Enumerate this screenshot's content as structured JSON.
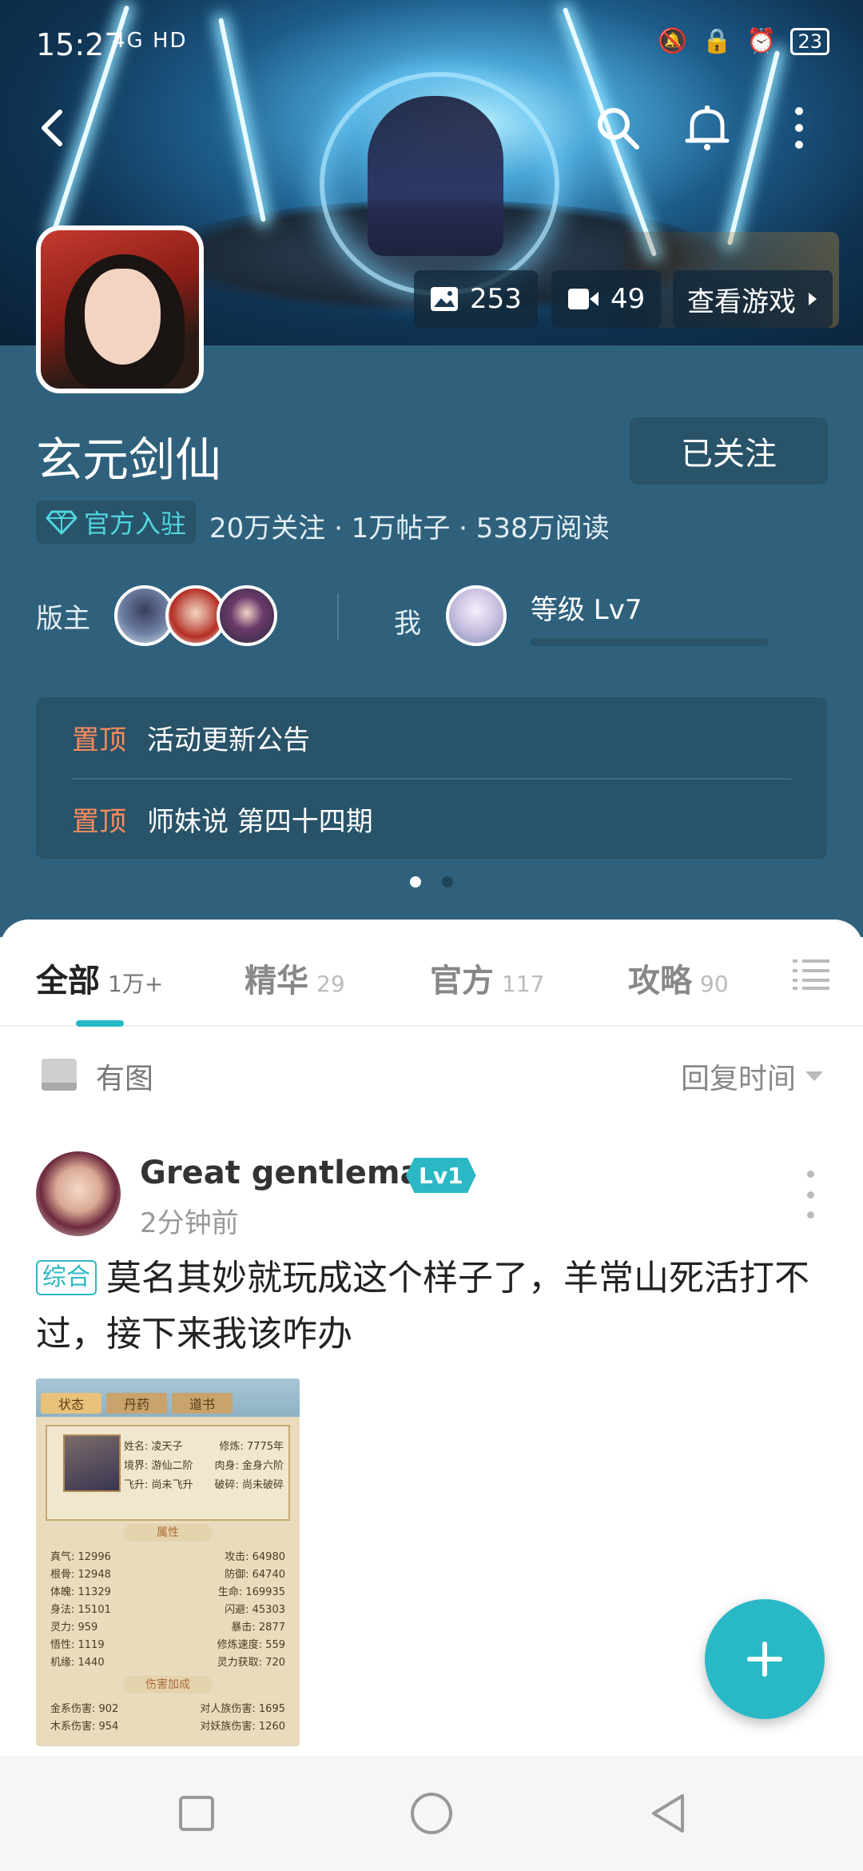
{
  "status_bar": {
    "time": "15:27",
    "signal_text": "4G HD",
    "battery": "23"
  },
  "top_nav": {
    "back_icon": "chevron-left-icon",
    "search_icon": "search-icon",
    "bell_icon": "bell-icon",
    "more_icon": "more-vertical-icon"
  },
  "media": {
    "images_count": "253",
    "videos_count": "49",
    "view_game_label": "查看游戏"
  },
  "forum": {
    "title": "玄元剑仙",
    "follow_label": "已关注",
    "official_label": "官方入驻",
    "stats": "20万关注 · 1万帖子 · 538万阅读",
    "moderator_label": "版主",
    "me_label": "我",
    "level_text": "等级 Lv7",
    "level_progress": 0
  },
  "pinned": [
    {
      "tag": "置顶",
      "text": "活动更新公告"
    },
    {
      "tag": "置顶",
      "text": "师妹说 第四十四期"
    }
  ],
  "pager": {
    "pages": 2,
    "active": 0
  },
  "tabs": [
    {
      "name": "全部",
      "count": "1万+"
    },
    {
      "name": "精华",
      "count": "29"
    },
    {
      "name": "官方",
      "count": "117"
    },
    {
      "name": "攻略",
      "count": "90"
    }
  ],
  "filter": {
    "has_image_label": "有图",
    "sort_label": "回复时间"
  },
  "post": {
    "username": "Great gentleman",
    "level_badge": "Lv1",
    "time": "2分钟前",
    "category": "综合",
    "text": "莫名其妙就玩成这个样子了，羊常山死活打不过，接下来我该咋办",
    "screenshot": {
      "tabs": [
        "状态",
        "丹药",
        "道书"
      ],
      "profile": [
        [
          "姓名: 凌天子",
          "修炼: 7775年"
        ],
        [
          "境界: 游仙二阶",
          "肉身: 金身六阶"
        ],
        [
          "飞升: 尚未飞升",
          "破碎: 尚未破碎"
        ]
      ],
      "attr_header": "属性",
      "attrs": [
        [
          "真气: 12996",
          "攻击: 64980"
        ],
        [
          "根骨: 12948",
          "防御: 64740"
        ],
        [
          "体魄: 11329",
          "生命: 169935"
        ],
        [
          "身法: 15101",
          "闪避: 45303"
        ],
        [
          "灵力: 959",
          "暴击: 2877"
        ],
        [
          "悟性: 1119",
          "修炼速度: 559"
        ],
        [
          "机缘: 1440",
          "灵力获取: 720"
        ]
      ],
      "dmg_header": "伤害加成",
      "dmg": [
        [
          "金系伤害: 902",
          "对人族伤害: 1695"
        ],
        [
          "木系伤害: 954",
          "对妖族伤害: 1260"
        ]
      ]
    }
  },
  "colors": {
    "accent": "#29b9c6",
    "panel": "#2f617c",
    "pin_tag": "#ff8a5c"
  }
}
